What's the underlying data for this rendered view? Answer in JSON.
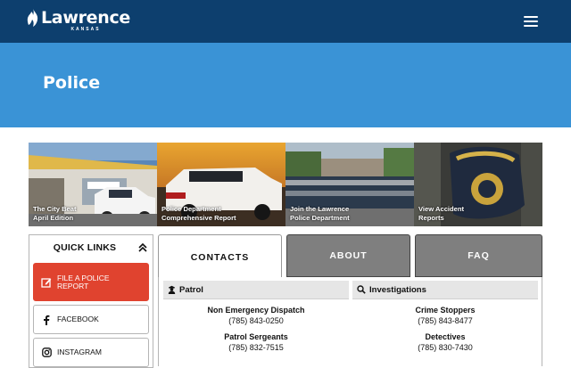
{
  "header": {
    "logo_word": "Lawrence",
    "logo_sub": "KANSAS",
    "bar_color": "#0d3f6e",
    "menu_icon": "hamburger-menu-icon"
  },
  "hero": {
    "title": "Police",
    "color": "#3a93d6"
  },
  "tiles": [
    {
      "label": "The City Beat\nApril Edition"
    },
    {
      "label": "Police Department\nComprehensive Report"
    },
    {
      "label": "Join the Lawrence\nPolice Department"
    },
    {
      "label": "View Accident\nReports"
    }
  ],
  "quick_links": {
    "title": "QUICK LINKS",
    "toggle_icon": "chevron-up-icon",
    "items": [
      {
        "label": "FILE A POLICE\nREPORT",
        "icon": "edit-icon",
        "color": "#e0432f"
      },
      {
        "label": "FACEBOOK",
        "icon": "facebook-icon"
      },
      {
        "label": "INSTAGRAM",
        "icon": "instagram-icon"
      }
    ]
  },
  "tabs": [
    {
      "label": "CONTACTS",
      "active": true
    },
    {
      "label": "ABOUT",
      "active": false
    },
    {
      "label": "FAQ",
      "active": false
    }
  ],
  "contacts": {
    "patrol": {
      "heading": "Patrol",
      "icon": "officer-icon",
      "entries": [
        {
          "name": "Non Emergency Dispatch",
          "phone": "(785) 843-0250"
        },
        {
          "name": "Patrol Sergeants",
          "phone": "(785) 832-7515"
        }
      ]
    },
    "investigations": {
      "heading": "Investigations",
      "icon": "search-icon",
      "entries": [
        {
          "name": "Crime Stoppers",
          "phone": "(785) 843-8477"
        },
        {
          "name": "Detectives",
          "phone": "(785) 830-7430"
        }
      ]
    }
  }
}
